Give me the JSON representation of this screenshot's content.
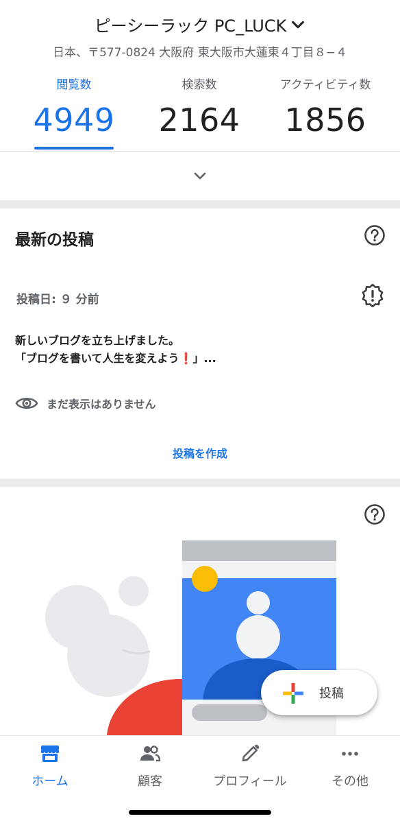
{
  "header": {
    "business_name": "ピーシーラック PC_LUCK",
    "address": "日本、〒577-0824 大阪府 東大阪市大蓮東４丁目８−４"
  },
  "stats": [
    {
      "label": "閲覧数",
      "value": "4949",
      "active": true
    },
    {
      "label": "検索数",
      "value": "2164",
      "active": false
    },
    {
      "label": "アクティビティ数",
      "value": "1856",
      "active": false
    }
  ],
  "latest_post": {
    "title": "最新の投稿",
    "date": "投稿日: ９ 分前",
    "body_line1": "新しいブログを立ち上げました。",
    "body_line2_before": "「ブログを書いて人生を変えよう",
    "body_line2_emoji": "❗",
    "body_line2_after": "」...",
    "views": "まだ表示はありません",
    "create_label": "投稿を作成"
  },
  "fab": {
    "label": "投稿"
  },
  "bottom_nav": [
    {
      "label": "ホーム",
      "icon": "storefront-icon",
      "active": true
    },
    {
      "label": "顧客",
      "icon": "people-icon",
      "active": false
    },
    {
      "label": "プロフィール",
      "icon": "pencil-icon",
      "active": false
    },
    {
      "label": "その他",
      "icon": "more-horizontal-icon",
      "active": false
    }
  ],
  "colors": {
    "accent": "#1a73e8",
    "google_red": "#ea4335",
    "google_yellow": "#fbbc04",
    "google_green": "#34a853",
    "google_blue": "#4285f4"
  }
}
